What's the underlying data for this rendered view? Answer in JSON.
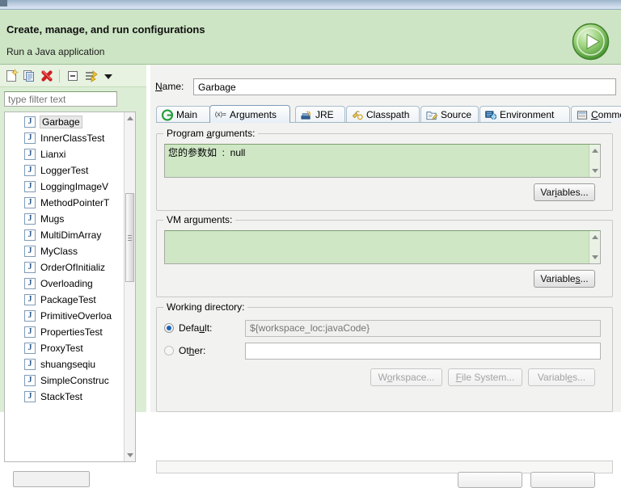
{
  "header": {
    "title": "Create, manage, and run configurations",
    "subtitle": "Run a Java application",
    "badge_icon": "run-play-icon"
  },
  "left_panel": {
    "toolbar": [
      {
        "name": "new-launch-configuration",
        "icon": "new-document-icon"
      },
      {
        "name": "duplicate-launch-configuration",
        "icon": "copy-icon"
      },
      {
        "name": "delete-launch-configuration",
        "icon": "delete-red-x-icon"
      },
      {
        "name": "collapse-all",
        "icon": "collapse-all-icon"
      },
      {
        "name": "filter-launch-configurations",
        "icon": "filter-icon"
      },
      {
        "name": "view-menu",
        "icon": "chevron-down-icon"
      }
    ],
    "filter": {
      "placeholder": "type filter text",
      "value": ""
    },
    "tree_items": [
      {
        "label": "Garbage",
        "icon": "java-class-icon",
        "selected": true
      },
      {
        "label": "InnerClassTest",
        "icon": "java-class-icon",
        "selected": false
      },
      {
        "label": "Lianxi",
        "icon": "java-class-icon",
        "selected": false
      },
      {
        "label": "LoggerTest",
        "icon": "java-class-icon",
        "selected": false
      },
      {
        "label": "LoggingImageV",
        "icon": "java-class-icon",
        "selected": false
      },
      {
        "label": "MethodPointerT",
        "icon": "java-class-icon",
        "selected": false
      },
      {
        "label": "Mugs",
        "icon": "java-class-icon",
        "selected": false
      },
      {
        "label": "MultiDimArray",
        "icon": "java-class-icon",
        "selected": false
      },
      {
        "label": "MyClass",
        "icon": "java-class-icon",
        "selected": false
      },
      {
        "label": "OrderOfInitializ",
        "icon": "java-class-icon",
        "selected": false
      },
      {
        "label": "Overloading",
        "icon": "java-class-icon",
        "selected": false
      },
      {
        "label": "PackageTest",
        "icon": "java-class-icon",
        "selected": false
      },
      {
        "label": "PrimitiveOverloa",
        "icon": "java-class-icon",
        "selected": false
      },
      {
        "label": "PropertiesTest",
        "icon": "java-class-icon",
        "selected": false
      },
      {
        "label": "ProxyTest",
        "icon": "java-class-icon",
        "selected": false
      },
      {
        "label": "shuangseqiu",
        "icon": "java-class-icon",
        "selected": false
      },
      {
        "label": "SimpleConstruc",
        "icon": "java-class-icon",
        "selected": false
      },
      {
        "label": "StackTest",
        "icon": "java-class-icon",
        "selected": false
      }
    ]
  },
  "main": {
    "name_field": {
      "label": "Name:",
      "label_mnemonic": "N",
      "value": "Garbage"
    },
    "tabs": [
      {
        "label": "Main",
        "icon": "main-green-g-icon",
        "active": false
      },
      {
        "label": "Arguments",
        "icon": "arguments-xequals-icon",
        "active": true
      },
      {
        "label": "JRE",
        "icon": "jre-icon",
        "active": false
      },
      {
        "label": "Classpath",
        "icon": "classpath-icon",
        "active": false
      },
      {
        "label": "Source",
        "icon": "source-folder-pencil-icon",
        "active": false
      },
      {
        "label": "Environment",
        "icon": "environment-icon",
        "active": false
      },
      {
        "label": "Common",
        "icon": "common-sheet-icon",
        "active": false
      }
    ],
    "program_arguments": {
      "group_label": "Program arguments:",
      "value": "您的参数如  :  null",
      "variables_button": "Variables..."
    },
    "vm_arguments": {
      "group_label": "VM arguments:",
      "value": "",
      "variables_button": "Variables..."
    },
    "working_directory": {
      "group_label": "Working directory:",
      "default_radio_label": "Default:",
      "default_radio_checked": true,
      "default_value": "${workspace_loc:javaCode}",
      "other_radio_label": "Other:",
      "other_radio_checked": false,
      "other_value": "",
      "buttons": [
        {
          "label": "Workspace...",
          "enabled": false
        },
        {
          "label": "File System...",
          "enabled": false
        },
        {
          "label": "Variables...",
          "enabled": false
        }
      ]
    }
  },
  "colors": {
    "header_green": "#cde5c4",
    "field_green": "#cfe7c5",
    "panel_bg": "#f2f2f0",
    "accent_blue": "#1b64b5",
    "delete_red": "#cc1f1f",
    "run_green": "#4fa832"
  }
}
